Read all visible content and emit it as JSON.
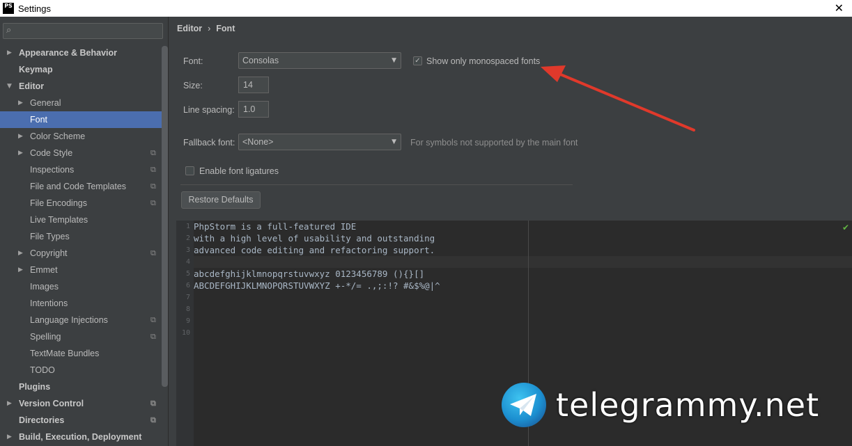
{
  "window": {
    "title": "Settings",
    "app_icon_text": "PS",
    "close_glyph": "✕"
  },
  "sidebar": {
    "search": {
      "value": "",
      "placeholder": ""
    },
    "items": [
      {
        "label": "Appearance & Behavior",
        "level": 0,
        "arrow": "▶",
        "bold": true
      },
      {
        "label": "Keymap",
        "level": 0,
        "arrow": "",
        "bold": true
      },
      {
        "label": "Editor",
        "level": 0,
        "arrow": "▼",
        "bold": true
      },
      {
        "label": "General",
        "level": 1,
        "arrow": "▶"
      },
      {
        "label": "Font",
        "level": 1,
        "arrow": "",
        "selected": true
      },
      {
        "label": "Color Scheme",
        "level": 1,
        "arrow": "▶"
      },
      {
        "label": "Code Style",
        "level": 1,
        "arrow": "▶",
        "copy": true
      },
      {
        "label": "Inspections",
        "level": 1,
        "arrow": "",
        "copy": true
      },
      {
        "label": "File and Code Templates",
        "level": 1,
        "arrow": "",
        "copy": true
      },
      {
        "label": "File Encodings",
        "level": 1,
        "arrow": "",
        "copy": true
      },
      {
        "label": "Live Templates",
        "level": 1,
        "arrow": ""
      },
      {
        "label": "File Types",
        "level": 1,
        "arrow": ""
      },
      {
        "label": "Copyright",
        "level": 1,
        "arrow": "▶",
        "copy": true
      },
      {
        "label": "Emmet",
        "level": 1,
        "arrow": "▶"
      },
      {
        "label": "Images",
        "level": 1,
        "arrow": ""
      },
      {
        "label": "Intentions",
        "level": 1,
        "arrow": ""
      },
      {
        "label": "Language Injections",
        "level": 1,
        "arrow": "",
        "copy": true
      },
      {
        "label": "Spelling",
        "level": 1,
        "arrow": "",
        "copy": true
      },
      {
        "label": "TextMate Bundles",
        "level": 1,
        "arrow": ""
      },
      {
        "label": "TODO",
        "level": 1,
        "arrow": ""
      },
      {
        "label": "Plugins",
        "level": 0,
        "arrow": "",
        "bold": true
      },
      {
        "label": "Version Control",
        "level": 0,
        "arrow": "▶",
        "bold": true,
        "copy": true
      },
      {
        "label": "Directories",
        "level": 0,
        "arrow": "",
        "bold": true,
        "copy": true
      },
      {
        "label": "Build, Execution, Deployment",
        "level": 0,
        "arrow": "▶",
        "bold": true
      }
    ]
  },
  "breadcrumb": {
    "parent": "Editor",
    "separator": "›",
    "current": "Font"
  },
  "font_settings": {
    "font_label": "Font:",
    "font_value": "Consolas",
    "monospaced_label": "Show only monospaced fonts",
    "monospaced_checked": true,
    "size_label": "Size:",
    "size_value": "14",
    "line_spacing_label": "Line spacing:",
    "line_spacing_value": "1.0",
    "fallback_label": "Fallback font:",
    "fallback_value": "<None>",
    "fallback_hint": "For symbols not supported by the main font",
    "ligatures_label": "Enable font ligatures",
    "ligatures_checked": false,
    "restore_label": "Restore Defaults"
  },
  "preview": {
    "lines": [
      "PhpStorm is a full-featured IDE",
      "with a high level of usability and outstanding",
      "advanced code editing and refactoring support.",
      "",
      "abcdefghijklmnopqrstuvwxyz 0123456789 (){}[]",
      "ABCDEFGHIJKLMNOPQRSTUVWXYZ +-*/= .,;:!? #&$%@|^",
      "",
      "",
      "",
      ""
    ],
    "line_numbers": [
      "1",
      "2",
      "3",
      "4",
      "5",
      "6",
      "7",
      "8",
      "9",
      "10"
    ]
  },
  "watermark": {
    "text": "telegrammy.net"
  },
  "colors": {
    "accent": "#4b6eaf",
    "background": "#3c3f41",
    "editor": "#2b2b2b",
    "arrow": "#e0392b"
  }
}
